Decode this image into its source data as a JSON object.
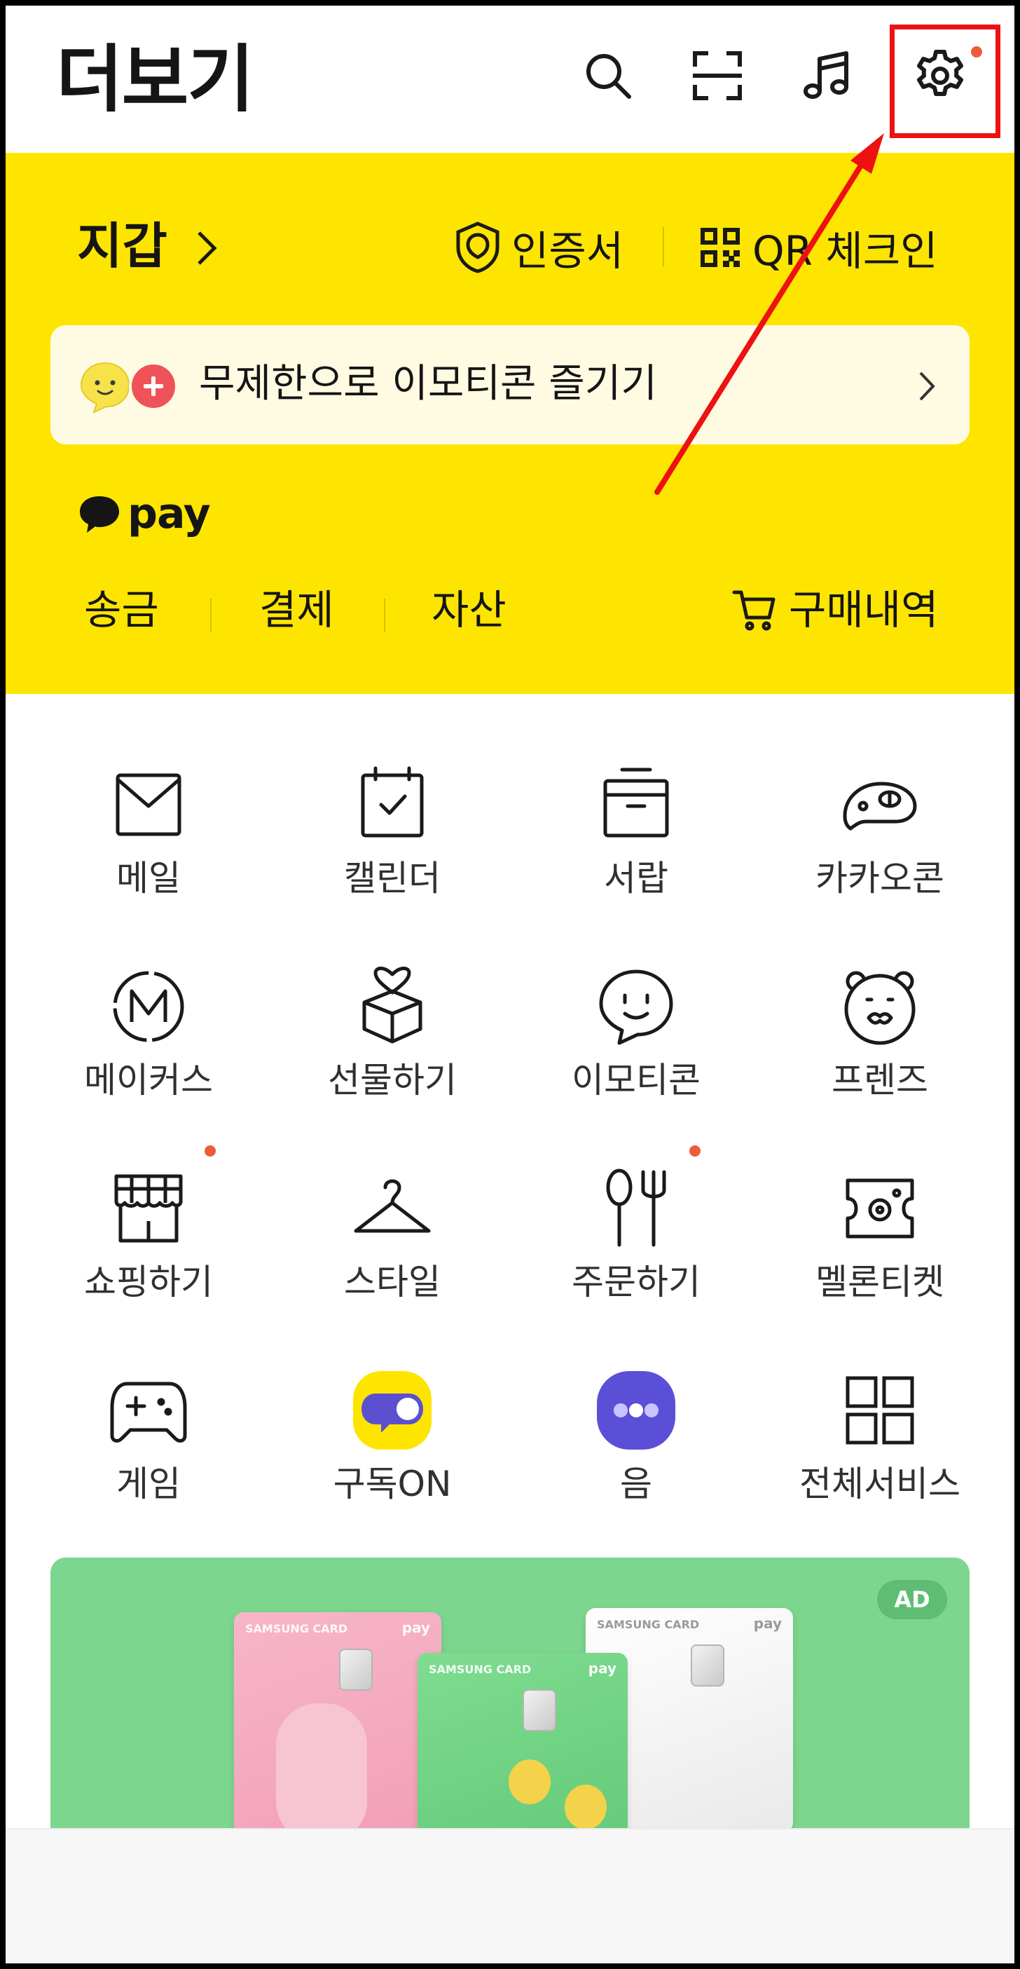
{
  "header": {
    "title": "더보기",
    "icons": [
      "search-icon",
      "scan-icon",
      "music-icon",
      "gear-icon"
    ],
    "settings_has_badge": true
  },
  "wallet": {
    "title": "지갑",
    "certificate_label": "인증서",
    "qr_checkin_label": "QR 체크인",
    "emoticon_banner_text": "무제한으로 이모티콘 즐기기",
    "pay_logo_text": "pay",
    "pay_menu": [
      "송금",
      "결제",
      "자산"
    ],
    "purchase_history_label": "구매내역"
  },
  "services": [
    {
      "label": "메일",
      "icon": "mail-icon",
      "badge": false
    },
    {
      "label": "캘린더",
      "icon": "calendar-icon",
      "badge": false
    },
    {
      "label": "서랍",
      "icon": "drawer-icon",
      "badge": false
    },
    {
      "label": "카카오콘",
      "icon": "kakaocon-icon",
      "badge": false
    },
    {
      "label": "메이커스",
      "icon": "makers-icon",
      "badge": false
    },
    {
      "label": "선물하기",
      "icon": "gift-icon",
      "badge": false
    },
    {
      "label": "이모티콘",
      "icon": "emoticon-icon",
      "badge": false
    },
    {
      "label": "프렌즈",
      "icon": "friends-icon",
      "badge": false
    },
    {
      "label": "쇼핑하기",
      "icon": "shop-icon",
      "badge": true
    },
    {
      "label": "스타일",
      "icon": "hanger-icon",
      "badge": false
    },
    {
      "label": "주문하기",
      "icon": "order-icon",
      "badge": true
    },
    {
      "label": "멜론티켓",
      "icon": "ticket-icon",
      "badge": false
    },
    {
      "label": "게임",
      "icon": "gamepad-icon",
      "badge": false
    },
    {
      "label": "구독ON",
      "icon": "subscribe-on-icon",
      "badge": false
    },
    {
      "label": "음",
      "icon": "eum-icon",
      "badge": false
    },
    {
      "label": "전체서비스",
      "icon": "all-services-icon",
      "badge": false
    }
  ],
  "ad": {
    "badge": "AD",
    "card_brand": "SAMSUNG CARD",
    "card_pay": "pay"
  },
  "colors": {
    "wallet_yellow": "#fee500",
    "badge_dot": "#ee5b3a",
    "annotation_red": "#ee1111",
    "ad_green": "#7dd68e"
  }
}
